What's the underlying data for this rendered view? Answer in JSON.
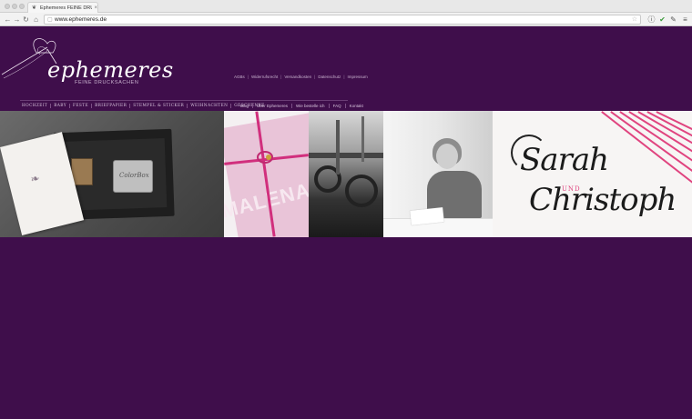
{
  "browser": {
    "tab_title": "Ephemeres FEINE DRUCK",
    "tab_close": "×",
    "url": "www.ephemeres.de",
    "nav_icons": [
      "back-icon",
      "forward-icon",
      "reload-icon",
      "home-icon"
    ],
    "extension_icons": [
      "info-icon",
      "check-icon",
      "extension-icon",
      "menu-icon"
    ]
  },
  "site": {
    "logo_word": "ephemeres",
    "logo_sub": "FEINE DRUCKSACHEN",
    "top_links": [
      "AGBs",
      "Widerrufsrecht",
      "Versandkosten",
      "Datenschutz",
      "Impressum"
    ],
    "main_nav": [
      "HOCHZEIT",
      "BABY",
      "FESTE",
      "BRIEFPAPIER",
      "STEMPEL & STICKER",
      "WEIHNACHTEN",
      "GESCHENKE"
    ],
    "secondary_nav": [
      "Blog",
      "Über Ephemeres",
      "Wie bestelle ich",
      "FAQ",
      "Kontakt"
    ],
    "hero": {
      "stamp_label": "ColorBox",
      "card_text": "MALENA",
      "calligraphy_first": "Sarah",
      "calligraphy_und": "UND",
      "calligraphy_second": "Christoph"
    }
  },
  "colors": {
    "background": "#3f0e4b",
    "accent_pink": "#d12f7d",
    "nav_text": "#d6c3db"
  }
}
